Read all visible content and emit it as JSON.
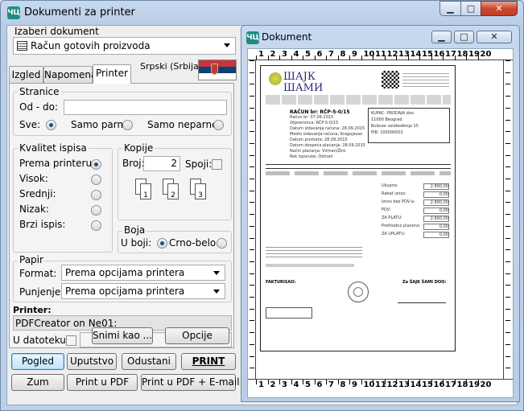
{
  "window": {
    "title": "Dokumenti za printer",
    "icon_text": "ЧЦ"
  },
  "document_select": {
    "label": "Izaberi dokument",
    "value": "Račun gotovih proizvoda"
  },
  "tabs": [
    {
      "label": "Izgled"
    },
    {
      "label": "Napomena"
    },
    {
      "label": "Printer"
    }
  ],
  "language": {
    "label": "Srpski (Srbija)"
  },
  "stranice": {
    "title": "Stranice",
    "od_do_label": "Od - do:",
    "od_do_value": "",
    "sve_label": "Sve:",
    "parne_label": "Samo parne:",
    "neparne_label": "Samo neparne:"
  },
  "kvalitet": {
    "title": "Kvalitet ispisa",
    "items": [
      "Prema printeru:",
      "Visok:",
      "Srednji:",
      "Nizak:",
      "Brzi ispis:"
    ]
  },
  "kopije": {
    "title": "Kopije",
    "broj_label": "Broj:",
    "broj_value": "2",
    "spoji_label": "Spoji:",
    "icon_numbers": [
      "1",
      "2",
      "3"
    ]
  },
  "boja": {
    "title": "Boja",
    "u_boji_label": "U boji:",
    "crno_belo_label": "Crno-belo:"
  },
  "papir": {
    "title": "Papir",
    "format_label": "Format:",
    "format_value": "Prema opcijama printera",
    "punjenje_label": "Punjenje:",
    "punjenje_value": "Prema opcijama printera"
  },
  "printer": {
    "label": "Printer:",
    "value": "PDFCreator on Ne01:"
  },
  "u_datoteku": {
    "label": "U datoteku:",
    "value": ""
  },
  "buttons": {
    "snimi": "Snimi kao ...",
    "opcije": "Opcije",
    "pogled": "Pogled",
    "uputstvo": "Uputstvo",
    "odustani": "Odustani",
    "print": "PRINT",
    "zum": "Zum",
    "print_pdf": "Print u PDF",
    "print_pdf_email": "Print u PDF + E-mail"
  },
  "preview_window": {
    "title": "Dokument",
    "icon_text": "ЧЦ"
  },
  "ruler": {
    "numbers": [
      "1",
      "2",
      "3",
      "4",
      "5",
      "6",
      "7",
      "8",
      "9",
      "10",
      "11",
      "12",
      "13",
      "14",
      "15",
      "16",
      "17",
      "18",
      "19",
      "20"
    ]
  },
  "doc": {
    "logo_top": "ШАЈК",
    "logo_bottom": "ШАМИ",
    "title": "RAČUN br: RČP-5-0/15",
    "rows_left": [
      "Račun br: 07.09.2015",
      "Otpremnica: RČP-5-0/15",
      "Datum izdavanja računa: 28.09.2015",
      "Mesto izdavanja računa: Kragujevac",
      "Datum prometa: 28.09.2015",
      "Datum dospeća plaćanja: 28.09.2015",
      "Način plaćanja: Virman/Žiro",
      "Rok isporuke: Odmah"
    ],
    "buyer_lines": [
      "KUPAC: PRODAJA doo",
      "11000 Beograd",
      "Bulevar oslobođenja 15",
      "PIB: 100000001"
    ],
    "totals_labels": [
      "Ukupno:",
      "Rabat iznos:",
      "Iznos bez PDV-a:",
      "PDV:",
      "ZA PLATU:",
      "Prethodno plaćeno:",
      "ZA UPLATU:"
    ],
    "totals_values": [
      "2.800,00",
      "0,00",
      "2.800,00",
      "0,00",
      "2.800,00",
      "0,00",
      "0,00"
    ],
    "fakturisao": "FAKTURISAO:",
    "za_kupca": "Za ŠAJK ŠAMI DOO:"
  }
}
